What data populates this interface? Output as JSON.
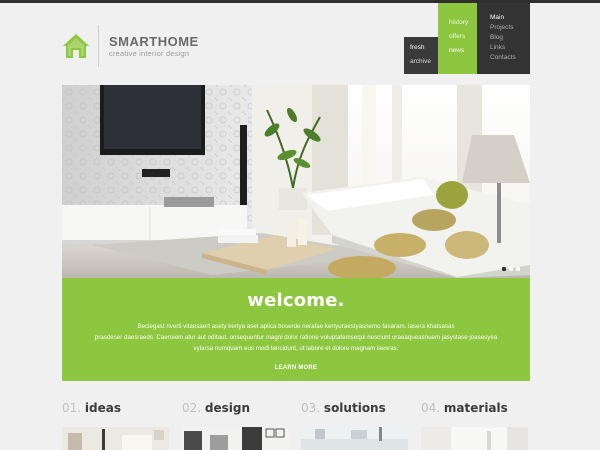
{
  "brand": {
    "name": "SMARTHOME",
    "tagline": "creative interior design"
  },
  "nav": {
    "secondary": [
      "fresh",
      "archive"
    ],
    "green": [
      "history",
      "offers",
      "news"
    ],
    "main": [
      "Main",
      "Projects",
      "Blog",
      "Links",
      "Contacts"
    ]
  },
  "slider": {
    "slide_count": 3,
    "active_slide": 1
  },
  "welcome": {
    "title": "welcome.",
    "body_lines": [
      "Beclegast nverti vitaesaert asety kertya aset aplica boserde nerafae kertyuraestyasnemo fasaram. iasera khatsasas",
      "prasdeser daesraeds. Caeroiem atur aut oditaut. onsequuntur magni dolor ratione voluptatemsequi nesciunt oraeaqueasnuem jasystase joasesyea",
      "vylarsa numquam eus modi tencidunt, ut labore et dolore magnam iaesras."
    ],
    "more_label": "LEARN MORE"
  },
  "features": [
    {
      "num": "01.",
      "label": "ideas"
    },
    {
      "num": "02.",
      "label": "design"
    },
    {
      "num": "03.",
      "label": "solutions"
    },
    {
      "num": "04.",
      "label": "materials"
    }
  ],
  "colors": {
    "accent_green": "#8dc63f",
    "dark_nav": "#333333",
    "page_bg": "#f0f0f0"
  },
  "icons": {
    "logo": "house-icon"
  }
}
